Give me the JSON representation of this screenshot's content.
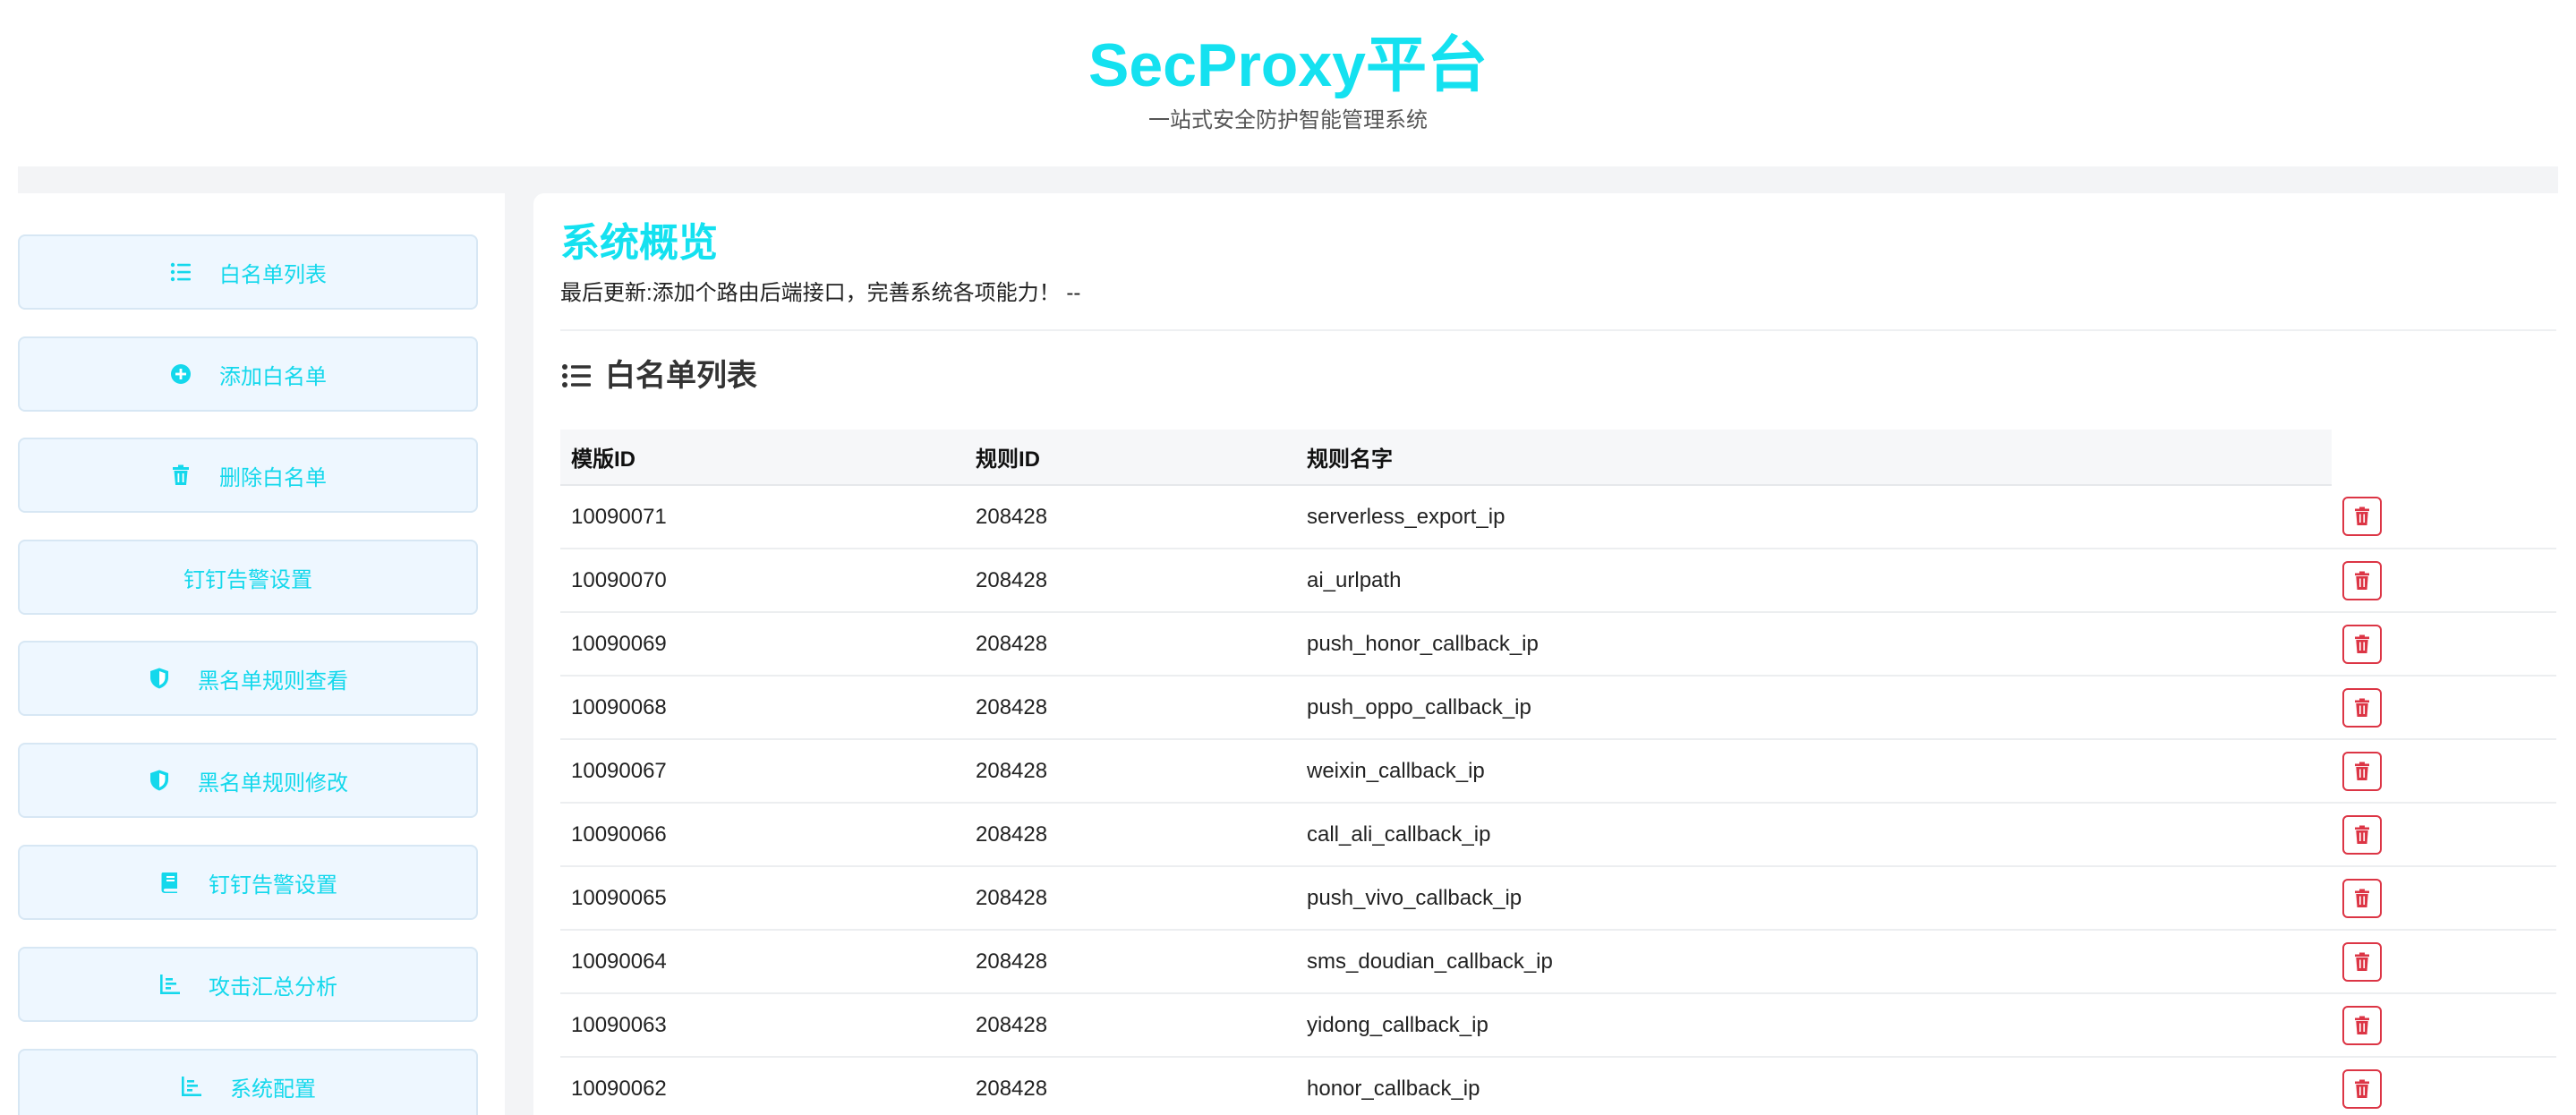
{
  "header": {
    "title": "SecProxy平台",
    "subtitle": "一站式安全防护智能管理系统"
  },
  "sidebar": {
    "items": [
      {
        "label": "白名单列表",
        "icon": "list-icon"
      },
      {
        "label": "添加白名单",
        "icon": "plus-circle-icon"
      },
      {
        "label": "删除白名单",
        "icon": "trash-icon"
      },
      {
        "label": "钉钉告警设置",
        "icon": ""
      },
      {
        "label": "黑名单规则查看",
        "icon": "shield-icon"
      },
      {
        "label": "黑名单规则修改",
        "icon": "shield-icon"
      },
      {
        "label": "钉钉告警设置",
        "icon": "book-icon"
      },
      {
        "label": "攻击汇总分析",
        "icon": "chart-icon"
      },
      {
        "label": "系统配置",
        "icon": "chart-icon"
      }
    ]
  },
  "main": {
    "title": "系统概览",
    "update_text": "最后更新:添加个路由后端接口，完善系统各项能力！ --",
    "section_title": "白名单列表",
    "table": {
      "headers": [
        "模版ID",
        "规则ID",
        "规则名字"
      ],
      "rows": [
        [
          "10090071",
          "208428",
          "serverless_export_ip"
        ],
        [
          "10090070",
          "208428",
          "ai_urlpath"
        ],
        [
          "10090069",
          "208428",
          "push_honor_callback_ip"
        ],
        [
          "10090068",
          "208428",
          "push_oppo_callback_ip"
        ],
        [
          "10090067",
          "208428",
          "weixin_callback_ip"
        ],
        [
          "10090066",
          "208428",
          "call_ali_callback_ip"
        ],
        [
          "10090065",
          "208428",
          "push_vivo_callback_ip"
        ],
        [
          "10090064",
          "208428",
          "sms_doudian_callback_ip"
        ],
        [
          "10090063",
          "208428",
          "yidong_callback_ip"
        ],
        [
          "10090062",
          "208428",
          "honor_callback_ip"
        ]
      ]
    }
  },
  "colors": {
    "accent": "#14e1f0",
    "danger": "#dc3545",
    "sidebar_bg": "#eef7ff"
  }
}
